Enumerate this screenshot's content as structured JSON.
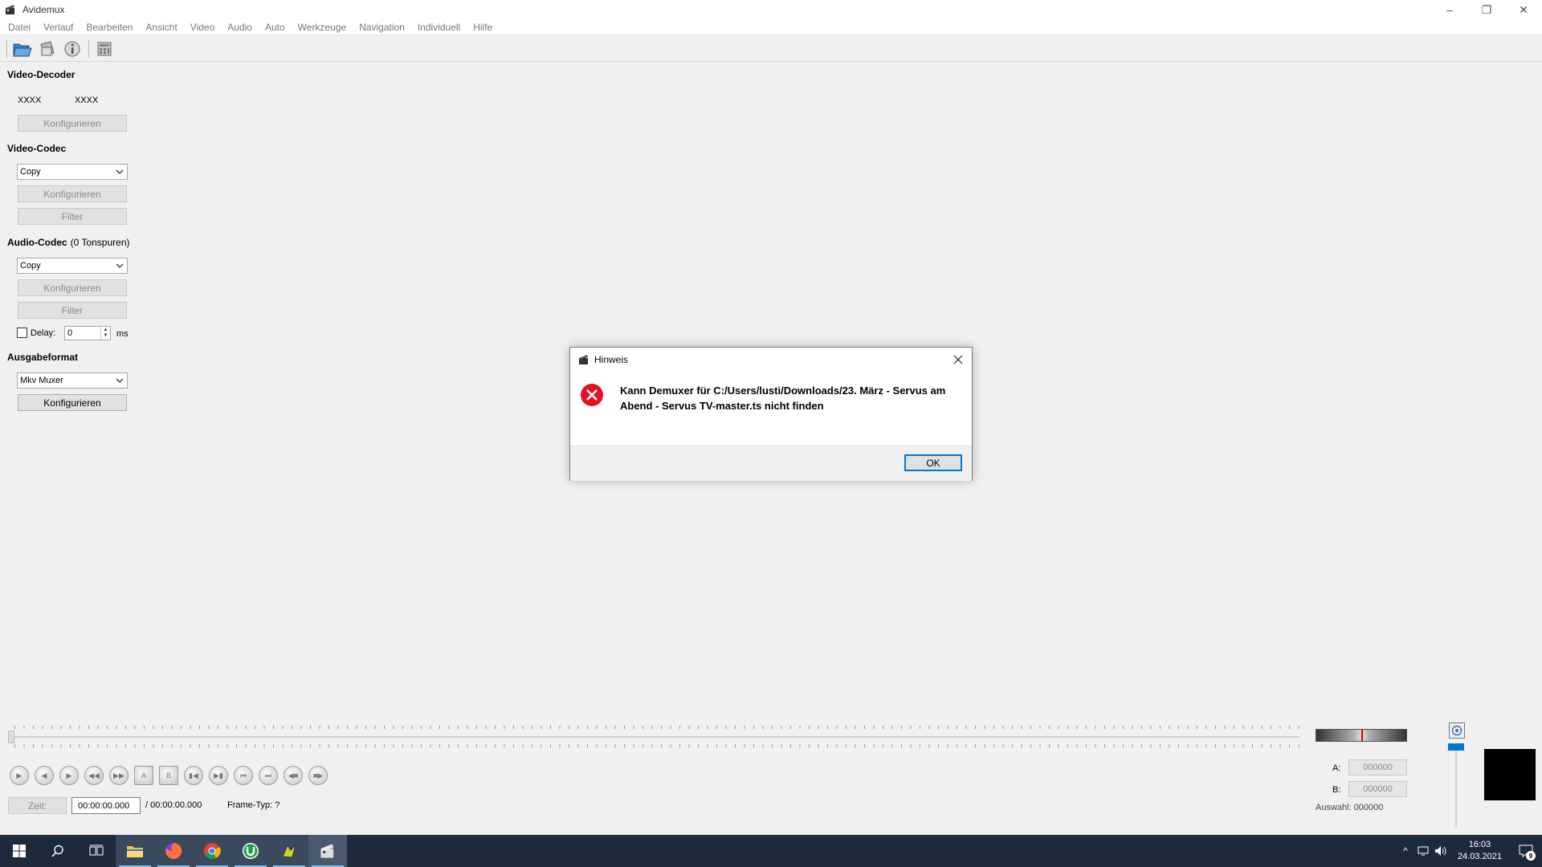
{
  "app": {
    "title": "Avidemux"
  },
  "window_controls": {
    "minimize": "–",
    "maximize": "❐",
    "close": "✕"
  },
  "menu": [
    "Datei",
    "Verlauf",
    "Bearbeiten",
    "Ansicht",
    "Video",
    "Audio",
    "Auto",
    "Werkzeuge",
    "Navigation",
    "Individuell",
    "Hilfe"
  ],
  "toolbar": {
    "icons": [
      "open-file-icon",
      "save-icon",
      "info-icon",
      "calculator-icon"
    ]
  },
  "video_decoder": {
    "title": "Video-Decoder",
    "value1": "XXXX",
    "value2": "XXXX",
    "configure_label": "Konfigurieren"
  },
  "video_codec": {
    "title": "Video-Codec",
    "selected": "Copy",
    "configure_label": "Konfigurieren",
    "filter_label": "Filter"
  },
  "audio_codec": {
    "title": "Audio-Codec",
    "subtitle": "(0 Tonspuren)",
    "selected": "Copy",
    "configure_label": "Konfigurieren",
    "filter_label": "Filter",
    "delay_label": "Delay:",
    "delay_value": "0",
    "delay_unit": "ms"
  },
  "output_format": {
    "title": "Ausgabeformat",
    "selected": "Mkv Muxer",
    "configure_label": "Konfigurieren"
  },
  "dialog": {
    "title": "Hinweis",
    "message": "Kann Demuxer für C:/Users/lusti/Downloads/23. März - Servus am Abend - Servus TV-master.ts nicht finden",
    "ok_label": "OK"
  },
  "time": {
    "button_label": "Zeit:",
    "current": "00:00:00.000",
    "duration": "/ 00:00:00.000",
    "frame_type": "Frame-Typ:  ?"
  },
  "selection": {
    "a_label": "A:",
    "a_value": "000000",
    "b_label": "B:",
    "b_value": "000000",
    "auswahl": "Auswahl: 000000"
  },
  "taskbar": {
    "time": "16:03",
    "date": "24.03.2021",
    "notification_count": "9"
  },
  "colors": {
    "accent": "#0078d7",
    "error": "#e81123",
    "taskbar": "#1c2a3a"
  }
}
